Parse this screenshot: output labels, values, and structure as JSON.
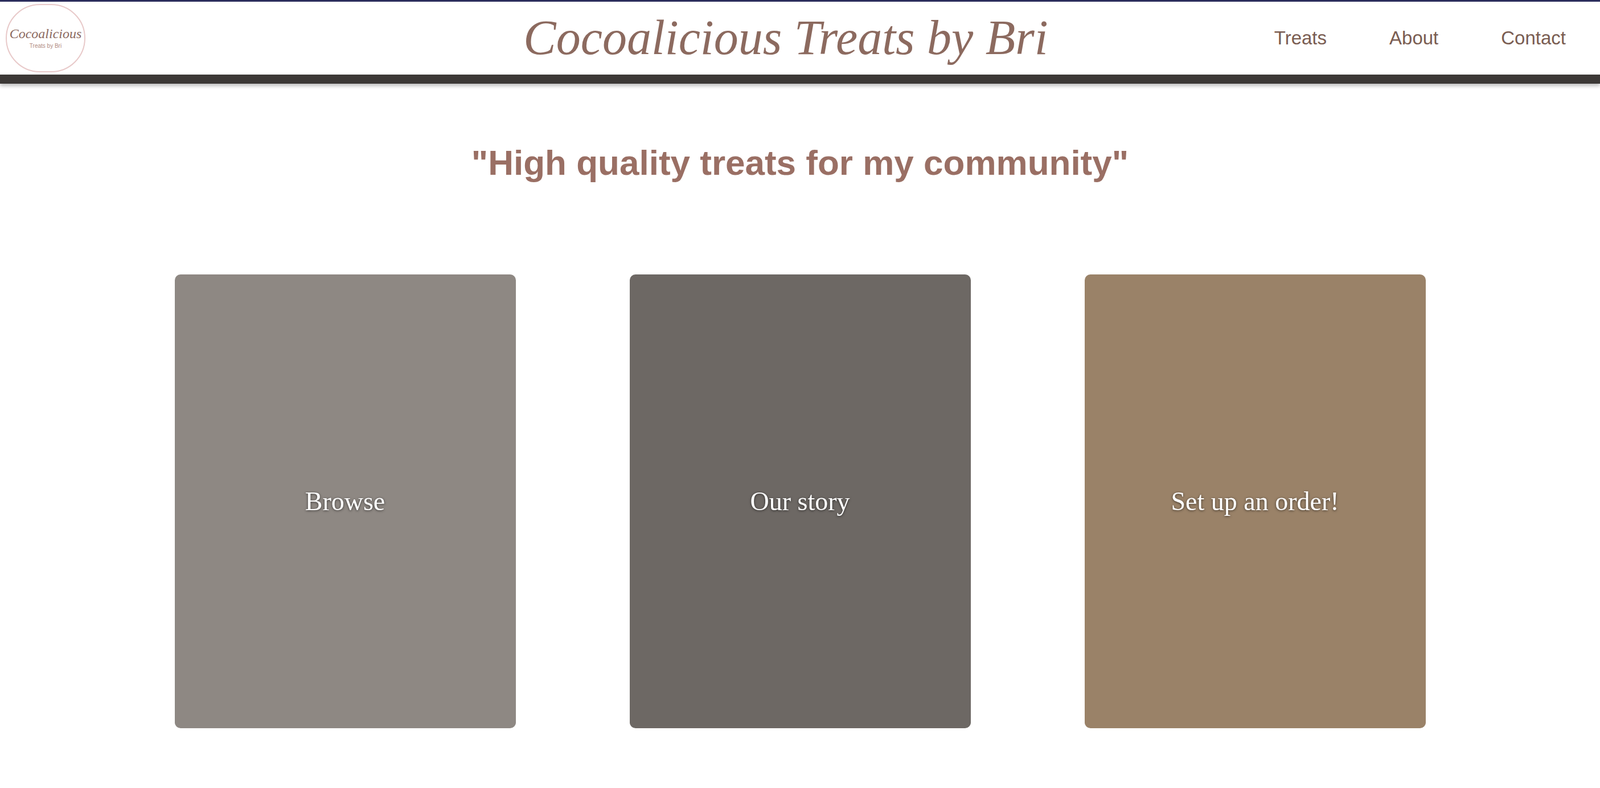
{
  "header": {
    "logo": {
      "title": "Cocoalicious",
      "subtitle": "Treats by Bri"
    },
    "title": "Cocoalicious Treats by Bri",
    "nav": [
      {
        "label": "Treats"
      },
      {
        "label": "About"
      },
      {
        "label": "Contact"
      }
    ]
  },
  "tagline": "\"High quality treats for my community\"",
  "cards": [
    {
      "label": "Browse",
      "color": "#8e8883"
    },
    {
      "label": "Our story",
      "color": "#6d6864"
    },
    {
      "label": "Set up an order!",
      "color": "#9a8268"
    }
  ]
}
